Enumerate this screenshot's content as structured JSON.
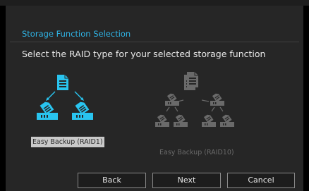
{
  "dialog": {
    "title": "Storage Function Selection",
    "instruction": "Select the RAID type for your selected storage function"
  },
  "options": [
    {
      "label": "Easy Backup (RAID1)",
      "selected": true,
      "icon": "raid1-diagram-icon"
    },
    {
      "label": "Easy Backup (RAID10)",
      "selected": false,
      "enabled": false,
      "icon": "raid10-diagram-icon"
    }
  ],
  "buttons": {
    "back": "Back",
    "next": "Next",
    "cancel": "Cancel"
  },
  "colors": {
    "accent": "#29c4ef",
    "title": "#2fb4e6",
    "text": "#e8e8e8",
    "disabled": "#6a6a6a",
    "selected_bg": "#c9c9c9"
  }
}
